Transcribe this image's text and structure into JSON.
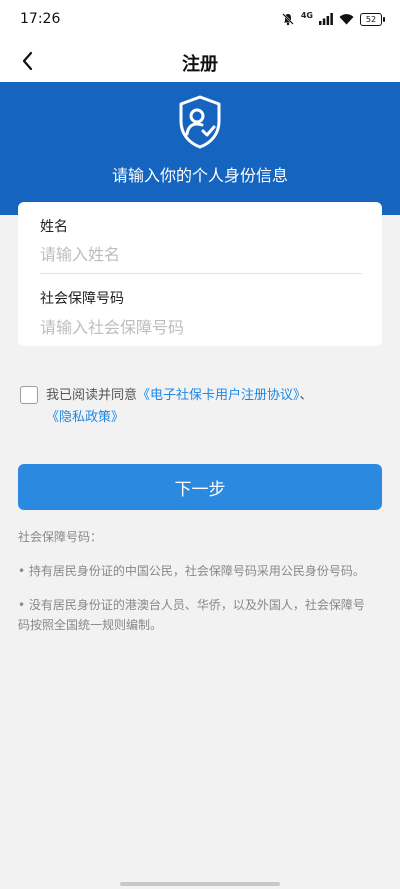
{
  "status_bar": {
    "time": "17:26",
    "network": "4G",
    "battery": "52",
    "icons": [
      "mute-icon",
      "signal-icon",
      "wifi-icon",
      "battery-icon"
    ]
  },
  "nav": {
    "title": "注册",
    "back_icon": "chevron-left-icon"
  },
  "hero": {
    "text": "请输入你的个人身份信息",
    "icon": "shield-user-check-icon",
    "color": "#1565c0"
  },
  "form": {
    "name_label": "姓名",
    "name_placeholder": "请输入姓名",
    "ssn_label": "社会保障号码",
    "ssn_placeholder": "请输入社会保障号码"
  },
  "agreement": {
    "prefix": "我已阅读并同意",
    "link1": "《电子社保卡用户注册协议》",
    "separator": "、",
    "link2": "《隐私政策》",
    "checked": false,
    "link_color": "#1e88e5"
  },
  "next_button": {
    "label": "下一步",
    "color": "#2b8ae0"
  },
  "notes": {
    "title": "社会保障号码：",
    "item1": "• 持有居民身份证的中国公民，社会保障号码采用公民身份号码。",
    "item2": "• 没有居民身份证的港澳台人员、华侨，以及外国人，社会保障号码按照全国统一规则编制。"
  }
}
